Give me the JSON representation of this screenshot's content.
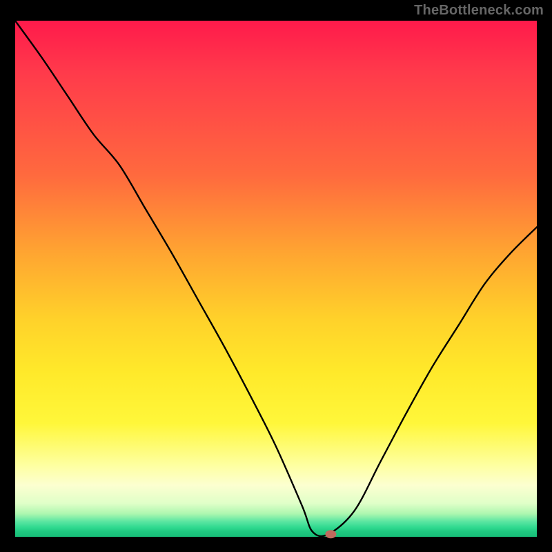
{
  "attribution": "TheBottleneck.com",
  "chart_data": {
    "type": "line",
    "title": "",
    "xlabel": "",
    "ylabel": "",
    "xlim": [
      0,
      100
    ],
    "ylim": [
      0,
      100
    ],
    "x": [
      0,
      5,
      10,
      15,
      20,
      25,
      30,
      35,
      40,
      45,
      50,
      55,
      57,
      60,
      65,
      70,
      75,
      80,
      85,
      90,
      95,
      100
    ],
    "y": [
      100,
      93,
      85.5,
      78,
      72,
      63.5,
      55,
      46,
      37,
      27.5,
      17.5,
      6,
      1,
      0.5,
      5,
      14.5,
      24,
      33,
      41,
      49,
      55,
      60
    ],
    "marker": {
      "x": 60.5,
      "y": 0.5
    },
    "background": "rainbow-heatmap-vertical"
  }
}
